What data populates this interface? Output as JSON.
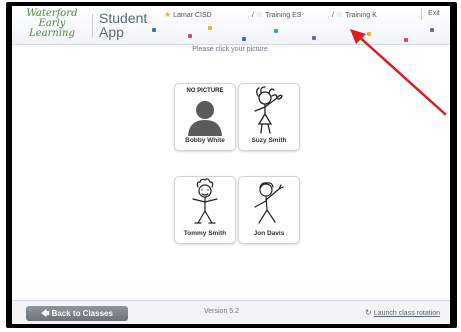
{
  "header": {
    "logo": [
      "Waterford",
      "Early",
      "Learning"
    ],
    "app_name": [
      "Student",
      "App"
    ],
    "breadcrumbs": [
      {
        "label": "Lamar CISD",
        "icon": "star-filled-icon"
      },
      {
        "label": "Training ES",
        "icon": "star-outline-icon"
      },
      {
        "label": "Training K",
        "icon": "star-outline-icon"
      }
    ],
    "separator": "/",
    "exit_label": "Exit"
  },
  "instruction": "Please click your picture.",
  "students": [
    {
      "name": "Bobby White",
      "picture": "none",
      "no_picture_label": "NO PICTURE"
    },
    {
      "name": "Suzy Smith",
      "picture": "drawing"
    },
    {
      "name": "Tommy Smith",
      "picture": "drawing"
    },
    {
      "name": "Jon Davis",
      "picture": "drawing"
    }
  ],
  "footer": {
    "back_label": "Back to Classes",
    "version": "Version 5.2",
    "launch_label": "Launch class rotation"
  },
  "colors": {
    "logo_green": "#4d8a3c",
    "star_gold": "#e1b92a",
    "back_button": "#7b828a",
    "annotation_red": "#e01b1b"
  }
}
